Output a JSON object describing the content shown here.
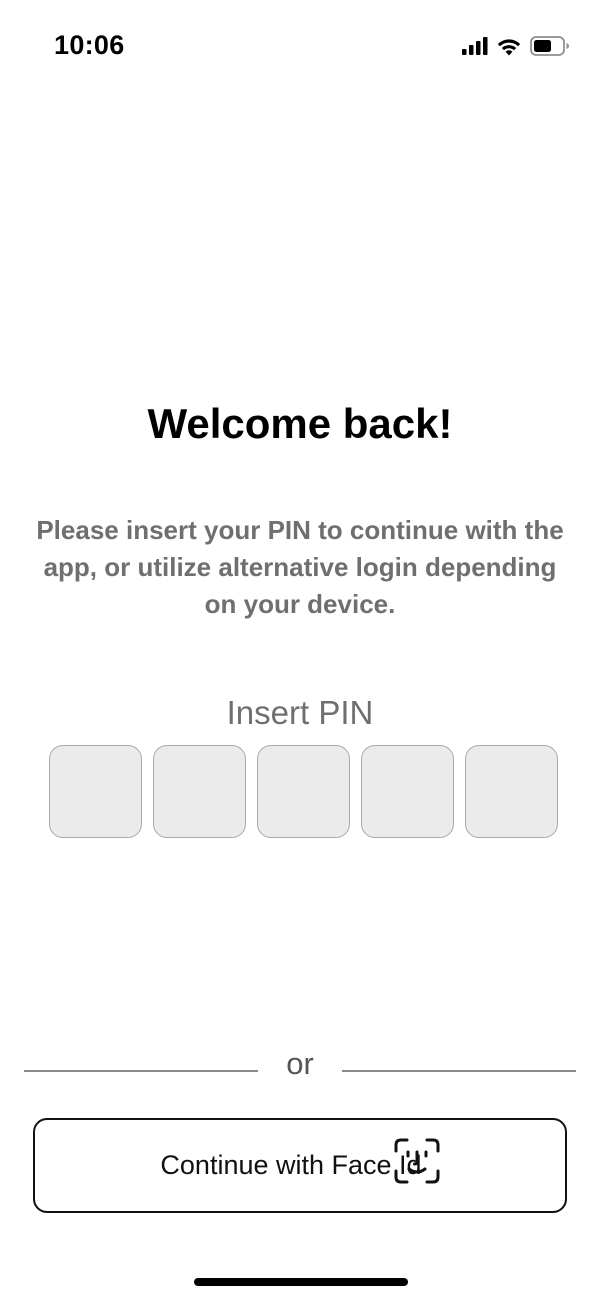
{
  "status_bar": {
    "time": "10:06",
    "icons": [
      "cellular-signal-icon",
      "wifi-icon",
      "battery-icon"
    ]
  },
  "welcome": {
    "title": "Welcome back!",
    "subtitle": "Please insert your PIN to continue with the app, or utilize alternative login depending on your device."
  },
  "pin": {
    "label": "Insert PIN",
    "length": 5,
    "digits": [
      "",
      "",
      "",
      "",
      ""
    ]
  },
  "divider": {
    "text": "or"
  },
  "faceid_button": {
    "label": "Continue with Face Id",
    "icon": "face-id-icon"
  },
  "colors": {
    "title": "#000000",
    "secondary_text": "#6f6f6f",
    "pin_box_fill": "#ebebeb",
    "pin_box_border": "#a9a9a9",
    "button_border": "#111111"
  }
}
